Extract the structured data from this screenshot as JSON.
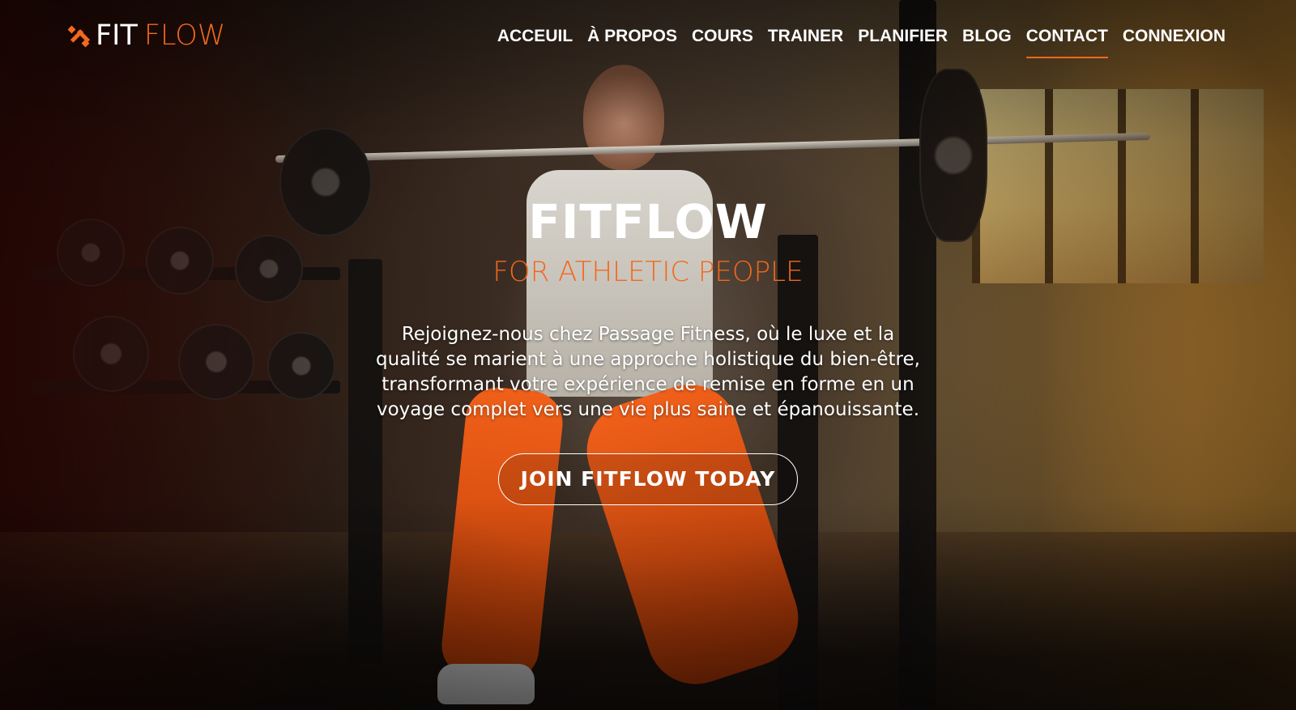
{
  "brand": {
    "logo_icon": "dumbbell-icon",
    "logo_fit": "FIT",
    "logo_flow": "FLOW",
    "accent_color": "#f2681e"
  },
  "nav": {
    "items": [
      {
        "label": "ACCEUIL"
      },
      {
        "label": "À PROPOS"
      },
      {
        "label": "COURS"
      },
      {
        "label": "TRAINER"
      },
      {
        "label": "PLANIFIER"
      },
      {
        "label": "BLOG"
      },
      {
        "label": "CONTACT",
        "active": true
      },
      {
        "label": "CONNEXION"
      }
    ]
  },
  "hero": {
    "title": "FITFLOW",
    "subtitle": "FOR ATHLETIC PEOPLE",
    "description": "Rejoignez-nous chez Passage Fitness, où le luxe et la qualité se marient à une approche holistique du bien-être, transformant votre expérience de remise en forme en un voyage complet vers une vie plus saine et épanouissante.",
    "cta_label": "JOIN FITFLOW TODAY"
  }
}
